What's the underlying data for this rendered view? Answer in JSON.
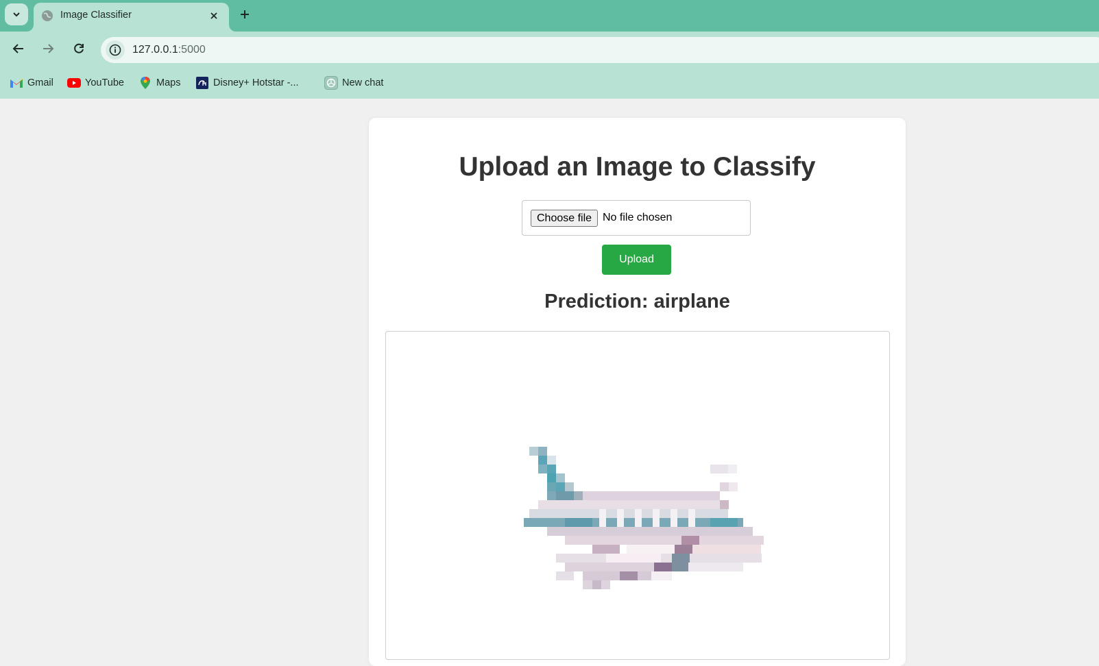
{
  "browser": {
    "tab": {
      "title": "Image Classifier"
    },
    "url": {
      "host": "127.0.0.1",
      "port": ":5000"
    },
    "bookmarks": [
      {
        "label": "Gmail",
        "icon": "gmail-icon"
      },
      {
        "label": "YouTube",
        "icon": "youtube-icon"
      },
      {
        "label": "Maps",
        "icon": "maps-icon"
      },
      {
        "label": "Disney+ Hotstar -...",
        "icon": "hotstar-icon"
      },
      {
        "label": "New chat",
        "icon": "chatgpt-icon"
      }
    ]
  },
  "page": {
    "title": "Upload an Image to Classify",
    "file_input": {
      "button_label": "Choose file",
      "status": "No file chosen"
    },
    "upload_label": "Upload",
    "prediction": "Prediction: airplane"
  },
  "colors": {
    "tabstrip": "#60bda1",
    "toolbar": "#b8e2d4",
    "page_background": "#f0f0f0",
    "upload_button": "#28a745",
    "heading_text": "#333333"
  }
}
